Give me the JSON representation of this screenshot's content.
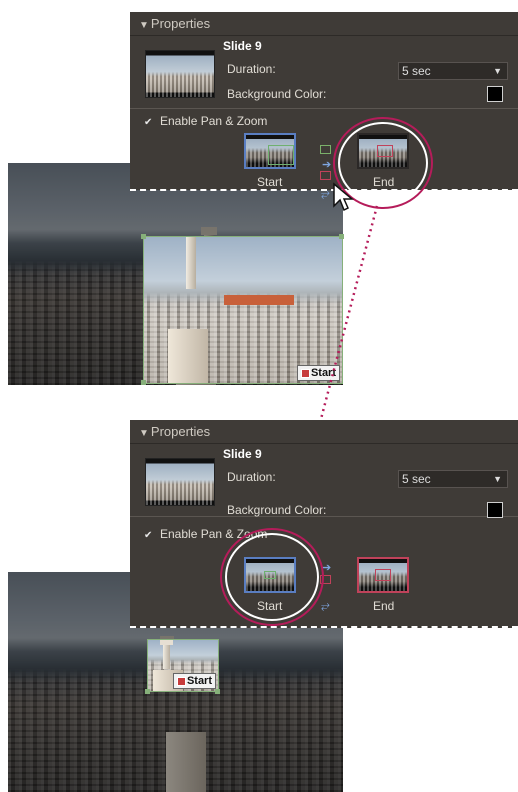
{
  "panel_top": {
    "header": "Properties",
    "slide_name": "Slide 9",
    "duration_label": "Duration:",
    "duration_value": "5 sec",
    "bg_color_label": "Background Color:",
    "enable_label": "Enable Pan & Zoom",
    "start_label": "Start",
    "end_label": "End"
  },
  "panel_bottom": {
    "header": "Properties",
    "slide_name": "Slide 9",
    "duration_label": "Duration:",
    "duration_value": "5 sec",
    "bg_color_label": "Background Color:",
    "enable_label": "Enable Pan & Zoom",
    "start_label": "Start",
    "end_label": "End"
  },
  "photo_top": {
    "frame_tag": "Start"
  },
  "photo_bottom": {
    "frame_tag": "Start"
  },
  "colors": {
    "panel_bg": "#3f3b37",
    "highlight_ring": "#b51c5a",
    "frame_green": "#86b07a",
    "end_red": "#c0425a",
    "start_blue": "#5a7ec2"
  },
  "icons": [
    "dropdown-arrow-icon",
    "checkbox-checked-icon",
    "pan-zoom-arrow-icon",
    "swap-frames-icon",
    "mouse-cursor-icon",
    "start-marker-icon"
  ]
}
